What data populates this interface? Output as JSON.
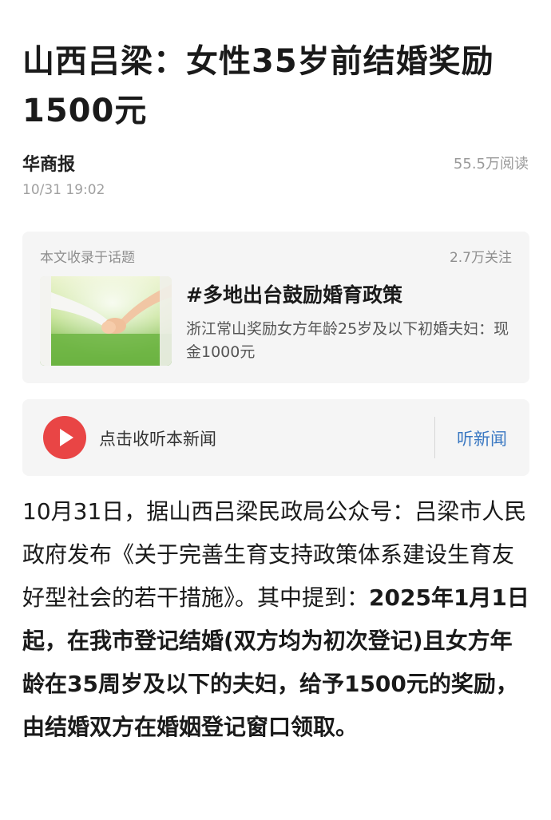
{
  "article": {
    "headline": "山西吕梁：女性35岁前结婚奖励1500元",
    "source": "华商报",
    "reads": "55.5万阅读",
    "time": "10/31 19:02"
  },
  "topic_card": {
    "caption": "本文收录于话题",
    "follow_count": "2.7万关注",
    "title": "#多地出台鼓励婚育政策",
    "description": "浙江常山奖励女方年龄25岁及以下初婚夫妇：现金1000元",
    "thumbnail_icon": "holding-hands-photo"
  },
  "audio": {
    "label": "点击收听本新闻",
    "link": "听新闻",
    "play_icon": "play-icon",
    "accent_color": "#e94545",
    "link_color": "#3a78c2"
  },
  "body": {
    "intro": "10月31日，据山西吕梁民政局公众号：吕梁市人民政府发布《关于完善生育支持政策体系建设生育友好型社会的若干措施》。其中提到：",
    "highlight": "2025年1月1日起，在我市登记结婚(双方均为初次登记)且女方年龄在35周岁及以下的夫妇，给予1500元的奖励，由结婚双方在婚姻登记窗口领取。"
  }
}
